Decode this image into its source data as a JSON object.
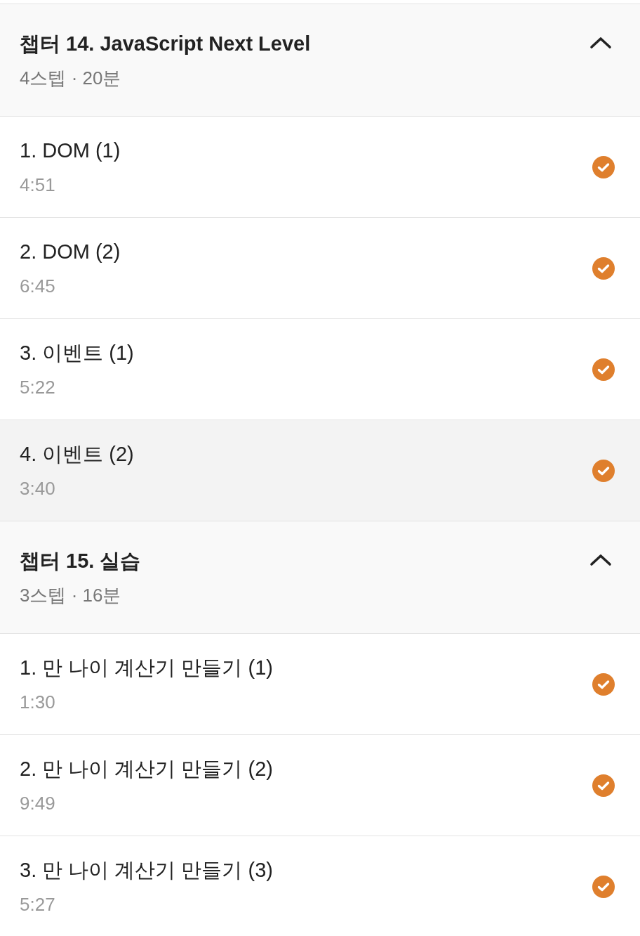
{
  "chapters": [
    {
      "title": "챕터 14. JavaScript Next Level",
      "summary": "4스텝 · 20분",
      "expanded": true,
      "steps": [
        {
          "title": "1. DOM (1)",
          "duration": "4:51",
          "completed": true,
          "selected": false
        },
        {
          "title": "2. DOM (2)",
          "duration": "6:45",
          "completed": true,
          "selected": false
        },
        {
          "title": "3. 이벤트 (1)",
          "duration": "5:22",
          "completed": true,
          "selected": false
        },
        {
          "title": "4. 이벤트 (2)",
          "duration": "3:40",
          "completed": true,
          "selected": true
        }
      ]
    },
    {
      "title": "챕터 15. 실습",
      "summary": "3스텝 · 16분",
      "expanded": true,
      "steps": [
        {
          "title": "1. 만 나이 계산기 만들기 (1)",
          "duration": "1:30",
          "completed": true,
          "selected": false
        },
        {
          "title": "2. 만 나이 계산기 만들기 (2)",
          "duration": "9:49",
          "completed": true,
          "selected": false
        },
        {
          "title": "3. 만 나이 계산기 만들기 (3)",
          "duration": "5:27",
          "completed": true,
          "selected": false
        }
      ]
    }
  ]
}
